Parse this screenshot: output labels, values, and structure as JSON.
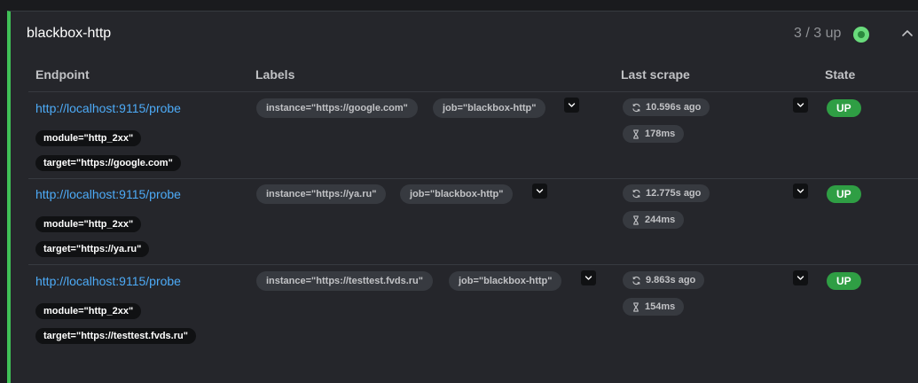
{
  "pool": {
    "title": "blackbox-http",
    "count": "3 / 3 up"
  },
  "columns": {
    "endpoint": "Endpoint",
    "labels": "Labels",
    "last_scrape": "Last scrape",
    "state": "State"
  },
  "targets": [
    {
      "endpoint": "http://localhost:9115/probe",
      "params": [
        "module=\"http_2xx\"",
        "target=\"https://google.com\""
      ],
      "labels": [
        "instance=\"https://google.com\"",
        "job=\"blackbox-http\""
      ],
      "last_scrape": "10.596s ago",
      "duration": "178ms",
      "state": "UP"
    },
    {
      "endpoint": "http://localhost:9115/probe",
      "params": [
        "module=\"http_2xx\"",
        "target=\"https://ya.ru\""
      ],
      "labels": [
        "instance=\"https://ya.ru\"",
        "job=\"blackbox-http\""
      ],
      "last_scrape": "12.775s ago",
      "duration": "244ms",
      "state": "UP"
    },
    {
      "endpoint": "http://localhost:9115/probe",
      "params": [
        "module=\"http_2xx\"",
        "target=\"https://testtest.fvds.ru\""
      ],
      "labels": [
        "instance=\"https://testtest.fvds.ru\"",
        "job=\"blackbox-http\""
      ],
      "last_scrape": "9.863s ago",
      "duration": "154ms",
      "state": "UP"
    }
  ],
  "colors": {
    "accent": "#40c057",
    "link": "#4dabf7",
    "state_up": "#2f9e44"
  }
}
